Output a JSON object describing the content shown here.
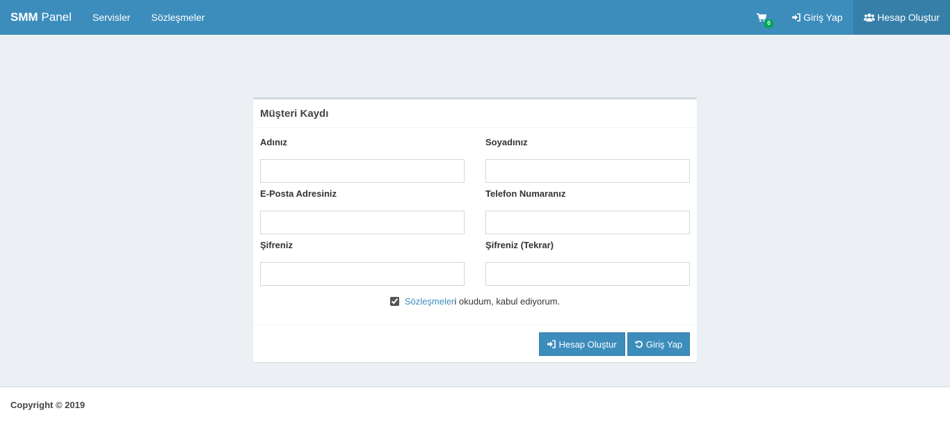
{
  "navbar": {
    "brand_bold": "SMM",
    "brand_light": "Panel",
    "links": [
      "Servisler",
      "Sözleşmeler"
    ],
    "cart_count": "0",
    "login_label": "Giriş Yap",
    "register_label": "Hesap Oluştur",
    "color": "#3c8dbc",
    "active_color": "#367fa9"
  },
  "form": {
    "title": "Müşteri Kaydı",
    "fields": [
      {
        "label": "Adınız",
        "value": ""
      },
      {
        "label": "Soyadınız",
        "value": ""
      },
      {
        "label": "E-Posta Adresiniz",
        "value": ""
      },
      {
        "label": "Telefon Numaranız",
        "value": ""
      },
      {
        "label": "Şifreniz",
        "value": ""
      },
      {
        "label": "Şifreniz (Tekrar)",
        "value": ""
      }
    ],
    "agreement_link": "Sözleşmeler",
    "agreement_link_suffix": "i",
    "agreement_text": " okudum, kabul ediyorum.",
    "agreement_checked": true,
    "create_button": "Hesap Oluştur",
    "login_button": "Giriş Yap"
  },
  "footer": {
    "copyright": "Copyright © 2019"
  }
}
